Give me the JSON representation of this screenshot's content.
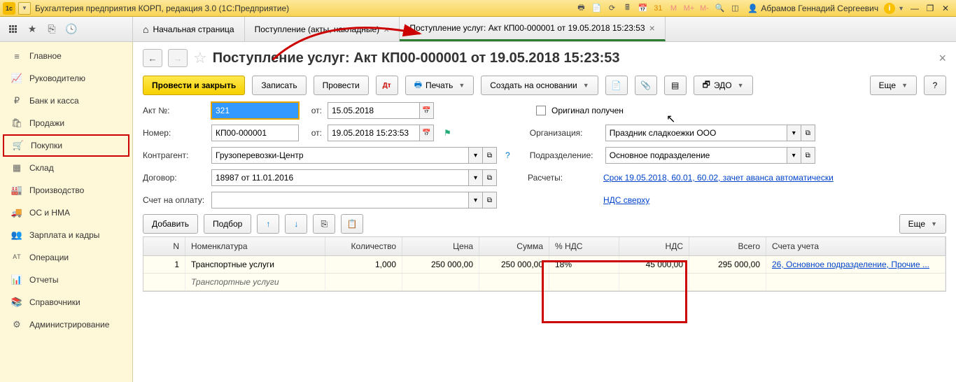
{
  "titlebar": {
    "app_title": "Бухгалтерия предприятия КОРП, редакция 3.0  (1С:Предприятие)",
    "user_name": "Абрамов Геннадий Сергеевич",
    "mem_labels": [
      "M",
      "M+",
      "M-"
    ]
  },
  "tabs": [
    {
      "label": "Начальная страница",
      "has_home": true,
      "closable": false
    },
    {
      "label": "Поступление (акты, накладные)",
      "closable": true
    },
    {
      "label": "Поступление услуг: Акт КП00-000001 от 19.05.2018 15:23:53",
      "closable": true,
      "active": true
    }
  ],
  "sidebar": [
    {
      "icon": "≡",
      "label": "Главное"
    },
    {
      "icon": "📈",
      "label": "Руководителю"
    },
    {
      "icon": "₽",
      "label": "Банк и касса"
    },
    {
      "icon": "🛍",
      "label": "Продажи"
    },
    {
      "icon": "🛒",
      "label": "Покупки",
      "active": true
    },
    {
      "icon": "▦",
      "label": "Склад"
    },
    {
      "icon": "🏭",
      "label": "Производство"
    },
    {
      "icon": "🚚",
      "label": "ОС и НМА"
    },
    {
      "icon": "👥",
      "label": "Зарплата и кадры"
    },
    {
      "icon": "ᴬᵀ",
      "label": "Операции"
    },
    {
      "icon": "📊",
      "label": "Отчеты"
    },
    {
      "icon": "📚",
      "label": "Справочники"
    },
    {
      "icon": "⚙",
      "label": "Администрирование"
    }
  ],
  "page": {
    "title": "Поступление услуг: Акт КП00-000001 от 19.05.2018 15:23:53",
    "actions": {
      "post_close": "Провести и закрыть",
      "save": "Записать",
      "post": "Провести",
      "print": "Печать",
      "create_based": "Создать на основании",
      "edo": "ЭДО",
      "more": "Еще"
    },
    "form": {
      "akt_label": "Акт №:",
      "akt_value": "321",
      "ot_label": "от:",
      "akt_date": "15.05.2018",
      "original_label": "Оригинал получен",
      "number_label": "Номер:",
      "number_value": "КП00-000001",
      "number_date": "19.05.2018 15:23:53",
      "org_label": "Организация:",
      "org_value": "Праздник сладкоежки ООО",
      "contractor_label": "Контрагент:",
      "contractor_value": "Грузоперевозки-Центр",
      "division_label": "Подразделение:",
      "division_value": "Основное подразделение",
      "contract_label": "Договор:",
      "contract_value": "18987 от 11.01.2016",
      "settlement_label": "Расчеты:",
      "settlement_link": "Срок 19.05.2018, 60.01, 60.02, зачет аванса автоматически",
      "invoice_label": "Счет на оплату:",
      "vat_link": "НДС сверху"
    },
    "table_toolbar": {
      "add": "Добавить",
      "select": "Подбор",
      "more": "Еще"
    },
    "table": {
      "headers": {
        "n": "N",
        "nom": "Номенклатура",
        "qty": "Количество",
        "price": "Цена",
        "sum": "Сумма",
        "vatp": "% НДС",
        "vat": "НДС",
        "total": "Всего",
        "acc": "Счета учета"
      },
      "rows": [
        {
          "n": "1",
          "nom": "Транспортные услуги",
          "nom2": "Транспортные услуги",
          "qty": "1,000",
          "price": "250 000,00",
          "sum": "250 000,00",
          "vatp": "18%",
          "vat": "45 000,00",
          "total": "295 000,00",
          "acc": "26, Основное подразделение, Прочие ..."
        }
      ]
    }
  }
}
